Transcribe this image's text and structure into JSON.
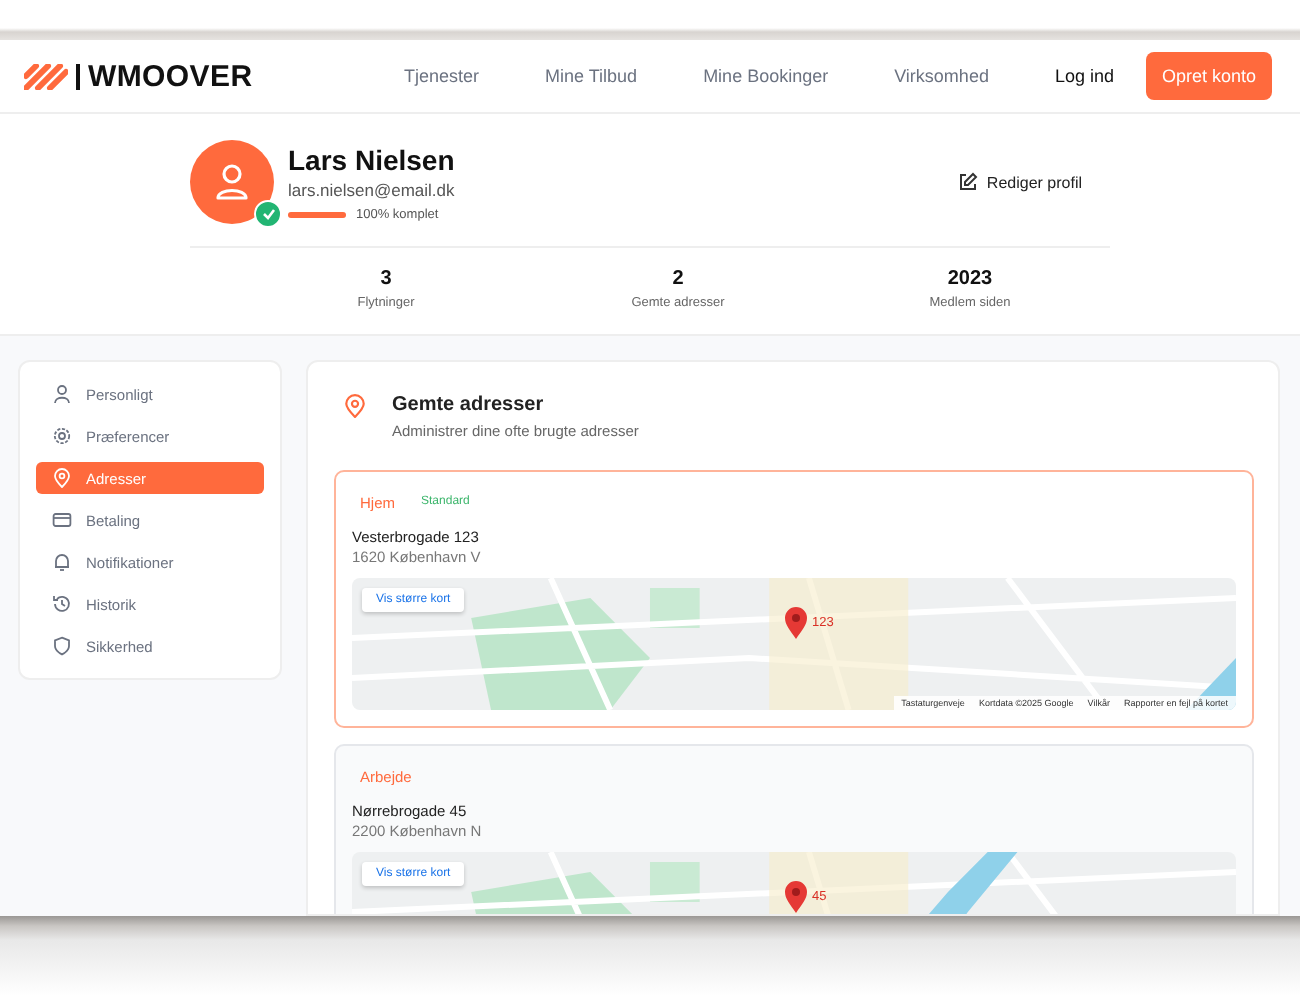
{
  "nav": {
    "logo": "WMOOVER",
    "links": [
      "Tjenester",
      "Mine Tilbud",
      "Mine Bookinger",
      "Virksomhed"
    ],
    "login": "Log ind",
    "signup": "Opret konto"
  },
  "profile": {
    "name": "Lars Nielsen",
    "email": "lars.nielsen@email.dk",
    "verified": true,
    "completion": {
      "level": 1,
      "label": "100% komplet"
    },
    "edit_button": "Rediger profil",
    "stats": [
      {
        "value": "3",
        "label": "Flytninger"
      },
      {
        "value": "2",
        "label": "Gemte adresser"
      },
      {
        "value": "2023",
        "label": "Medlem siden"
      }
    ]
  },
  "sidebar": {
    "items": [
      {
        "kind": "user",
        "label": "Personligt",
        "selected": false
      },
      {
        "kind": "gear",
        "label": "Præferencer",
        "selected": false
      },
      {
        "kind": "pin",
        "label": "Adresser",
        "selected": true
      },
      {
        "kind": "card",
        "label": "Betaling",
        "selected": false
      },
      {
        "kind": "bell",
        "label": "Notifikationer",
        "selected": false
      },
      {
        "kind": "history",
        "label": "Historik",
        "selected": false
      },
      {
        "kind": "shield",
        "label": "Sikkerhed",
        "selected": false
      }
    ]
  },
  "section": {
    "title": "Gemte adresser",
    "subtitle": "Administrer dine ofte brugte adresser"
  },
  "addresses": [
    {
      "label": "Hjem",
      "badge": "Standard",
      "selected": true,
      "street": "Vesterbrogade 123",
      "city": "1620 København V",
      "map": {
        "button": "Vis større kort",
        "marker": "123",
        "attribution": [
          "Tastaturgenveje",
          "Kortdata ©2025 Google",
          "Vilkår",
          "Rapporter en fejl på kortet"
        ]
      }
    },
    {
      "label": "Arbejde",
      "selected": false,
      "street": "Nørrebrogade 45",
      "city": "2200 København N",
      "map": {
        "button": "Vis større kort",
        "marker": "45"
      }
    }
  ]
}
